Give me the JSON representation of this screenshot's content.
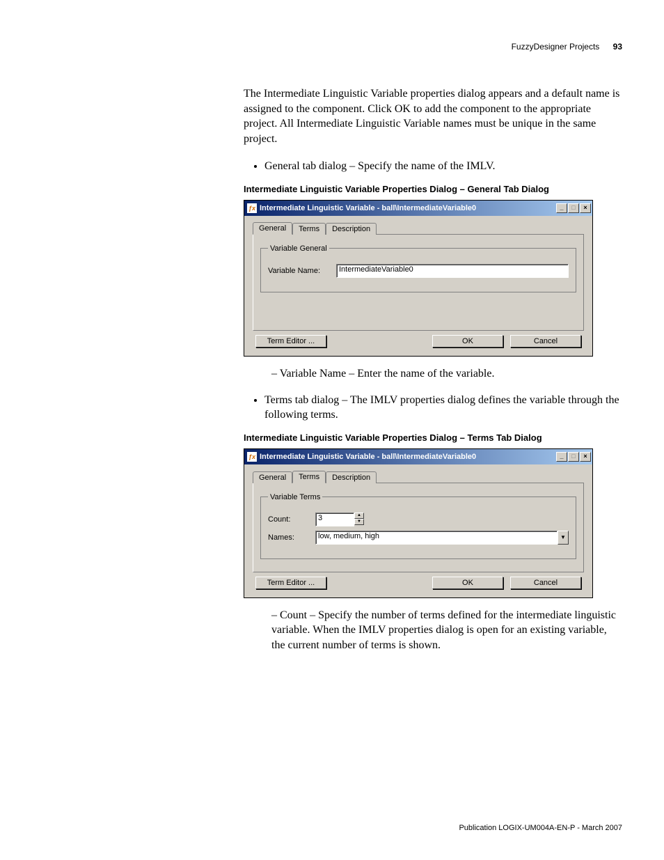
{
  "header": {
    "section": "FuzzyDesigner Projects",
    "page": "93"
  },
  "para1": "The Intermediate Linguistic Variable properties dialog appears and a default name is assigned to the component. Click OK to add the component to the appropriate project. All Intermediate Linguistic Variable names must be unique in the same project.",
  "bullet1": "General tab dialog – Specify the name of the IMLV.",
  "caption1": "Intermediate Linguistic Variable Properties Dialog – General Tab Dialog",
  "dialog1": {
    "title": "Intermediate Linguistic Variable - ball\\IntermediateVariable0",
    "tabs": {
      "general": "General",
      "terms": "Terms",
      "description": "Description"
    },
    "group": "Variable General",
    "varNameLabel": "Variable Name:",
    "varNameValue": "IntermediateVariable0",
    "termEditor": "Term Editor ...",
    "ok": "OK",
    "cancel": "Cancel"
  },
  "dash1": "Variable Name – Enter the name of the variable.",
  "bullet2": "Terms tab dialog – The IMLV properties dialog defines the variable through the following terms.",
  "caption2": "Intermediate Linguistic Variable Properties Dialog – Terms Tab Dialog",
  "dialog2": {
    "title": "Intermediate Linguistic Variable - ball\\IntermediateVariable0",
    "tabs": {
      "general": "General",
      "terms": "Terms",
      "description": "Description"
    },
    "group": "Variable Terms",
    "countLabel": "Count:",
    "countValue": "3",
    "namesLabel": "Names:",
    "namesValue": "low, medium, high",
    "termEditor": "Term Editor ...",
    "ok": "OK",
    "cancel": "Cancel"
  },
  "dash2": "Count – Specify the number of terms defined for the intermediate linguistic variable. When the IMLV properties dialog is open for an existing variable, the current number of terms is shown.",
  "footer": "Publication LOGIX-UM004A-EN-P - March 2007"
}
